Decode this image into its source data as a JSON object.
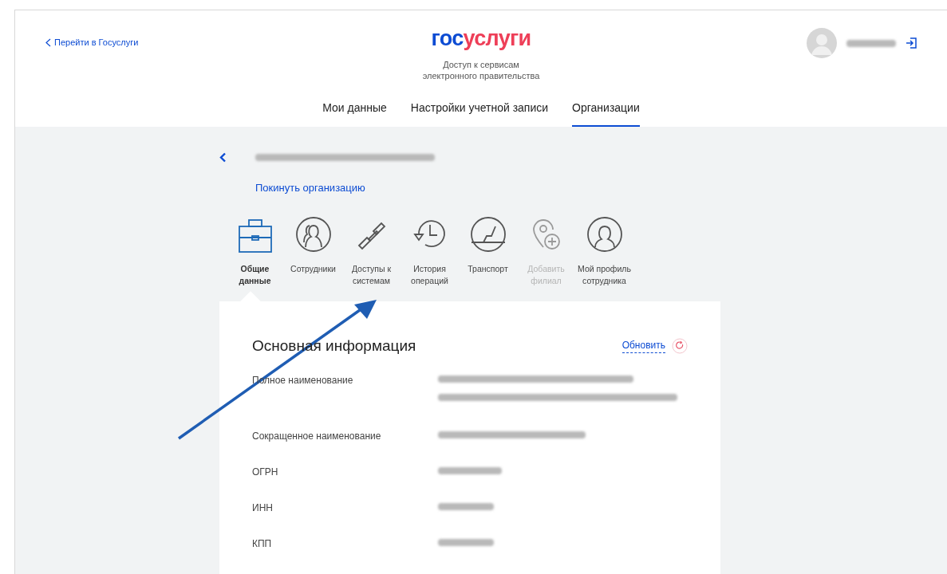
{
  "header": {
    "back_link": "Перейти в Госуслуги",
    "logo": {
      "part_1": "гос",
      "part_2": "услуги"
    },
    "subtitle": "Доступ к сервисам\nэлектронного правительства"
  },
  "tabs": [
    {
      "label": "Мои данные",
      "selected": false
    },
    {
      "label": "Настройки учетной записи",
      "selected": false
    },
    {
      "label": "Организации",
      "selected": true
    }
  ],
  "organization": {
    "leave_link": "Покинуть организацию"
  },
  "sections": [
    {
      "label": "Общие\nданные",
      "selected": true,
      "disabled": false
    },
    {
      "label": "Сотрудники",
      "selected": false,
      "disabled": false
    },
    {
      "label": "Доступы к\nсистемам",
      "selected": false,
      "disabled": false
    },
    {
      "label": "История\nопераций",
      "selected": false,
      "disabled": false
    },
    {
      "label": "Транспорт",
      "selected": false,
      "disabled": false
    },
    {
      "label": "Добавить\nфилиал",
      "selected": false,
      "disabled": true
    },
    {
      "label": "Мой профиль\nсотрудника",
      "selected": false,
      "disabled": false
    }
  ],
  "card": {
    "title": "Основная информация",
    "refresh": "Обновить",
    "rows": [
      {
        "label": "Полное наименование"
      },
      {
        "label": "Сокращенное наименование"
      },
      {
        "label": "ОГРН"
      },
      {
        "label": "ИНН"
      },
      {
        "label": "КПП"
      }
    ]
  }
}
